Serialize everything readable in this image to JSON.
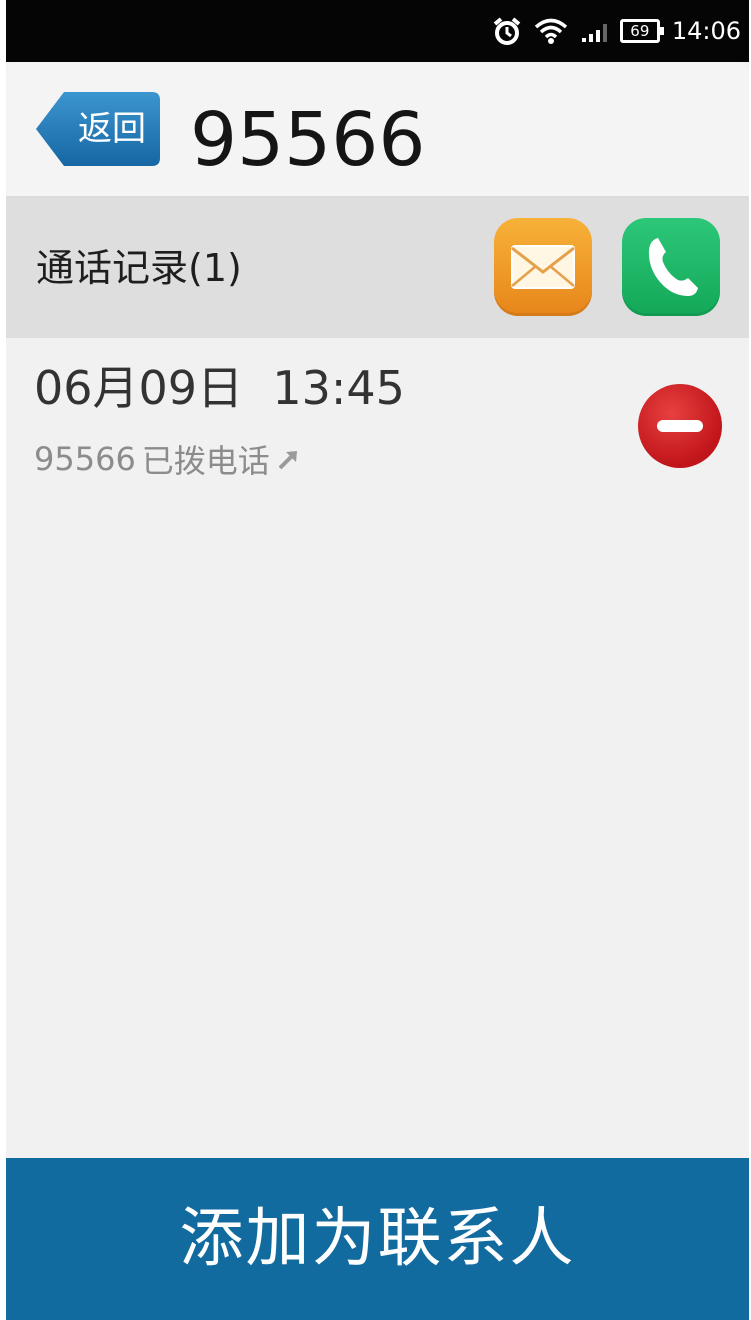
{
  "status_bar": {
    "time": "14:06",
    "battery_text": "69",
    "icons": [
      "alarm-icon",
      "wifi-icon",
      "signal-icon",
      "battery-icon"
    ]
  },
  "header": {
    "back_label": "返回",
    "title": "95566"
  },
  "call_log": {
    "title": "通话记录(1)",
    "actions": [
      "message-icon",
      "phone-icon"
    ],
    "records": [
      {
        "date": "06月09日",
        "time": "13:45",
        "number": "95566",
        "type": "已拨电话",
        "direction_icon": "outgoing-arrow-icon"
      }
    ]
  },
  "bottom_action": {
    "label": "添加为联系人"
  },
  "colors": {
    "status_bar": "#050505",
    "back_button": "#1c78b7",
    "message_button": "#f0a030",
    "call_button": "#21b866",
    "delete_button": "#d0181f",
    "bottom_bar": "#126b9f"
  }
}
